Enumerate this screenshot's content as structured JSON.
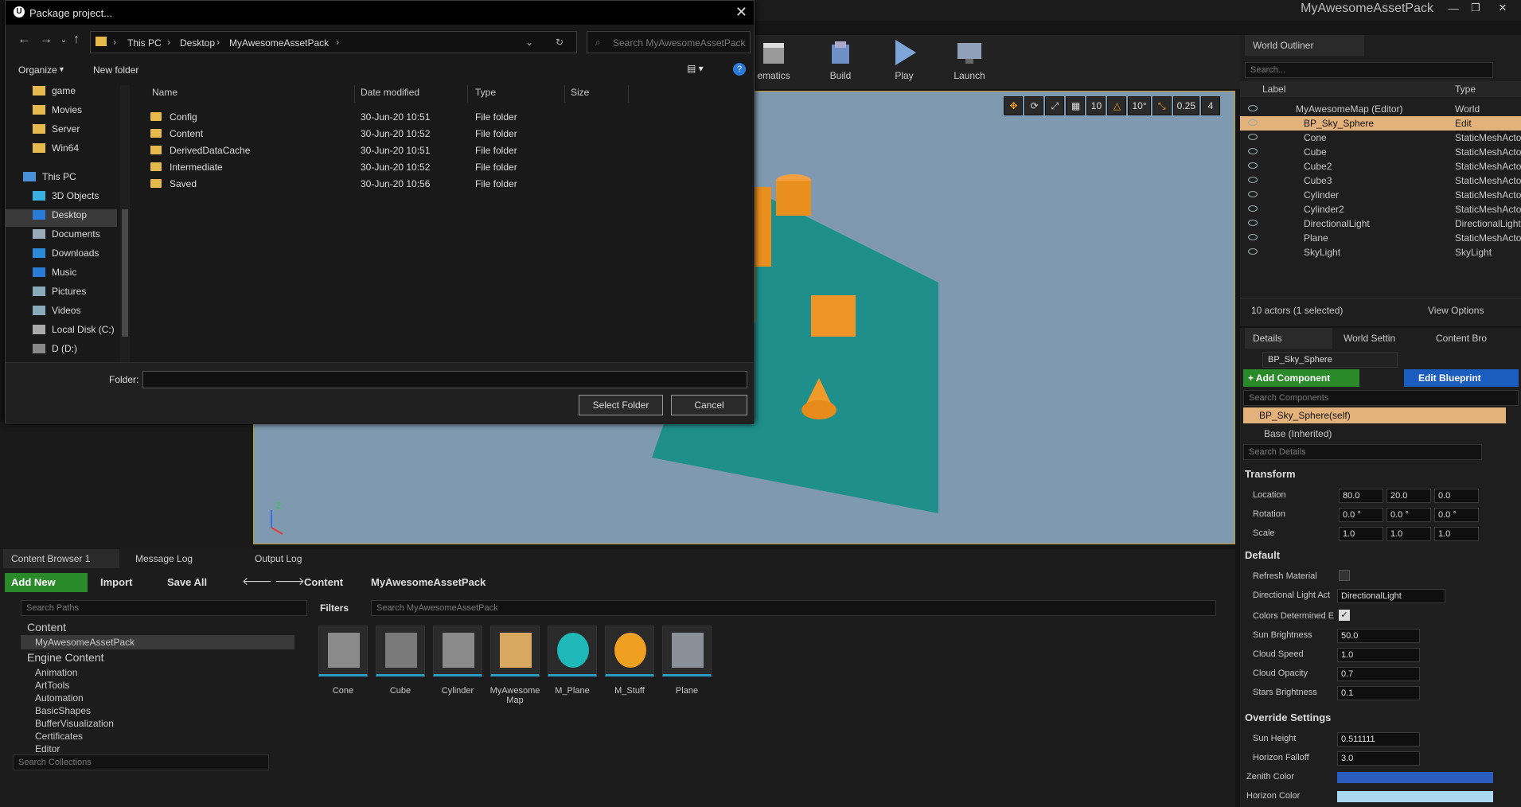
{
  "app": {
    "project_name": "MyAwesomeAssetPack"
  },
  "toolbar": {
    "cinematics": "ematics",
    "build": "Build",
    "play": "Play",
    "launch": "Launch"
  },
  "viewport": {
    "tools": [
      "10",
      "10°",
      "0.25",
      "4"
    ]
  },
  "dialog": {
    "title": "Package project...",
    "breadcrumb": [
      "This PC",
      "Desktop",
      "MyAwesomeAssetPack"
    ],
    "search_placeholder": "Search MyAwesomeAssetPack",
    "organize": "Organize",
    "new_folder": "New folder",
    "tree": [
      "game",
      "Movies",
      "Server",
      "Win64",
      "This PC",
      "3D Objects",
      "Desktop",
      "Documents",
      "Downloads",
      "Music",
      "Pictures",
      "Videos",
      "Local Disk (C:)",
      "D (D:)"
    ],
    "columns": {
      "name": "Name",
      "date": "Date modified",
      "type": "Type",
      "size": "Size"
    },
    "files": [
      {
        "name": "Config",
        "date": "30-Jun-20 10:51",
        "type": "File folder"
      },
      {
        "name": "Content",
        "date": "30-Jun-20 10:52",
        "type": "File folder"
      },
      {
        "name": "DerivedDataCache",
        "date": "30-Jun-20 10:51",
        "type": "File folder"
      },
      {
        "name": "Intermediate",
        "date": "30-Jun-20 10:52",
        "type": "File folder"
      },
      {
        "name": "Saved",
        "date": "30-Jun-20 10:56",
        "type": "File folder"
      }
    ],
    "folder_label": "Folder:",
    "folder_value": "",
    "select_folder": "Select Folder",
    "cancel": "Cancel"
  },
  "outliner": {
    "tab": "World Outliner",
    "search_placeholder": "Search...",
    "col_label": "Label",
    "col_type": "Type",
    "rows": [
      {
        "label": "MyAwesomeMap (Editor)",
        "type": "World"
      },
      {
        "label": "BP_Sky_Sphere",
        "type": "Edit BP_Sky_Sph"
      },
      {
        "label": "Cone",
        "type": "StaticMeshActor"
      },
      {
        "label": "Cube",
        "type": "StaticMeshActor"
      },
      {
        "label": "Cube2",
        "type": "StaticMeshActor"
      },
      {
        "label": "Cube3",
        "type": "StaticMeshActor"
      },
      {
        "label": "Cylinder",
        "type": "StaticMeshActor"
      },
      {
        "label": "Cylinder2",
        "type": "StaticMeshActor"
      },
      {
        "label": "DirectionalLight",
        "type": "DirectionalLight"
      },
      {
        "label": "Plane",
        "type": "StaticMeshActor"
      },
      {
        "label": "SkyLight",
        "type": "SkyLight"
      }
    ],
    "status": "10 actors (1 selected)",
    "view_options": "View Options"
  },
  "details": {
    "tabs": [
      "Details",
      "World Settin",
      "Content Bro"
    ],
    "actor_name": "BP_Sky_Sphere",
    "add_component": "+ Add Component",
    "edit_blueprint": "Edit Blueprint",
    "search_components": "Search Components",
    "self_component": "BP_Sky_Sphere(self)",
    "base": "Base (Inherited)",
    "search_details": "Search Details",
    "transform": "Transform",
    "location_label": "Location",
    "location": [
      "80.0",
      "20.0",
      "0.0"
    ],
    "rotation_label": "Rotation",
    "rotation": [
      "0.0 °",
      "0.0 °",
      "0.0 °"
    ],
    "scale_label": "Scale",
    "scale": [
      "1.0",
      "1.0",
      "1.0"
    ],
    "default": "Default",
    "refresh_material": "Refresh Material",
    "dir_light_label": "Directional Light Act",
    "dir_light_value": "DirectionalLight",
    "colors_determined": "Colors Determined E",
    "sun_brightness_label": "Sun Brightness",
    "sun_brightness": "50.0",
    "cloud_speed_label": "Cloud Speed",
    "cloud_speed": "1.0",
    "cloud_opacity_label": "Cloud Opacity",
    "cloud_opacity": "0.7",
    "stars_brightness_label": "Stars Brightness",
    "stars_brightness": "0.1",
    "override": "Override Settings",
    "sun_height_label": "Sun Height",
    "sun_height": "0.511111",
    "horizon_falloff_label": "Horizon Falloff",
    "horizon_falloff": "3.0",
    "zenith_color_label": "Zenith Color",
    "horizon_color_label": "Horizon Color",
    "zenith_color": "#2b5dbf",
    "horizon_color": "#a9d8f0"
  },
  "content_browser": {
    "tabs": [
      "Content Browser 1",
      "Message Log",
      "Output Log"
    ],
    "add_new": "Add New",
    "import": "Import",
    "save_all": "Save All",
    "path": [
      "Content",
      "MyAwesomeAssetPack"
    ],
    "search_paths": "Search Paths",
    "filters": "Filters",
    "search_assets": "Search MyAwesomeAssetPack",
    "tree": [
      "Content",
      "MyAwesomeAssetPack",
      "Engine Content",
      "Animation",
      "ArtTools",
      "Automation",
      "BasicShapes",
      "BufferVisualization",
      "Certificates",
      "Editor"
    ],
    "search_collections": "Search Collections",
    "assets": [
      "Cone",
      "Cube",
      "Cylinder",
      "MyAwesome Map",
      "M_Plane",
      "M_Stuff",
      "Plane"
    ]
  }
}
